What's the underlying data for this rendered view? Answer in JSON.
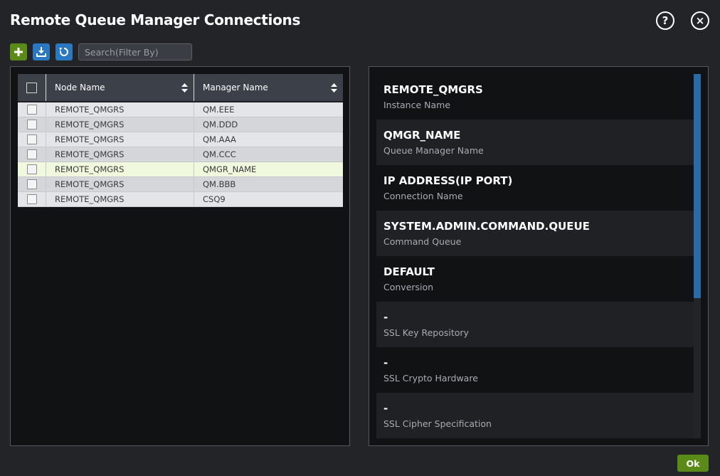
{
  "dialog": {
    "title": "Remote Queue Manager Connections",
    "help_glyph": "?",
    "close_glyph": "×",
    "ok_label": "Ok"
  },
  "toolbar": {
    "buttons": [
      "plus-icon",
      "download-icon",
      "refresh-icon"
    ],
    "search_placeholder": "Search(Filter By)"
  },
  "grid": {
    "columns": [
      "Node Name",
      "Manager Name"
    ],
    "rows": [
      {
        "node": "REMOTE_QMGRS",
        "manager": "QM.EEE",
        "selected": false
      },
      {
        "node": "REMOTE_QMGRS",
        "manager": "QM.DDD",
        "selected": false
      },
      {
        "node": "REMOTE_QMGRS",
        "manager": "QM.AAA",
        "selected": false
      },
      {
        "node": "REMOTE_QMGRS",
        "manager": "QM.CCC",
        "selected": false
      },
      {
        "node": "REMOTE_QMGRS",
        "manager": "QMGR_NAME",
        "selected": true
      },
      {
        "node": "REMOTE_QMGRS",
        "manager": "QM.BBB",
        "selected": false
      },
      {
        "node": "REMOTE_QMGRS",
        "manager": "CSQ9",
        "selected": false
      }
    ]
  },
  "details": [
    {
      "value": "REMOTE_QMGRS",
      "label": "Instance Name"
    },
    {
      "value": "QMGR_NAME",
      "label": "Queue Manager Name"
    },
    {
      "value": "IP ADDRESS(IP PORT)",
      "label": "Connection Name"
    },
    {
      "value": "SYSTEM.ADMIN.COMMAND.QUEUE",
      "label": "Command Queue"
    },
    {
      "value": "DEFAULT",
      "label": "Conversion"
    },
    {
      "value": "-",
      "label": "SSL Key Repository"
    },
    {
      "value": "-",
      "label": "SSL Crypto Hardware"
    },
    {
      "value": "-",
      "label": "SSL Cipher Specification"
    }
  ],
  "colors": {
    "background": "#222428",
    "panel": "#111214",
    "accent_green": "#5a8a18",
    "accent_blue": "#2a78c0",
    "selected_row": "#f0f8de"
  }
}
